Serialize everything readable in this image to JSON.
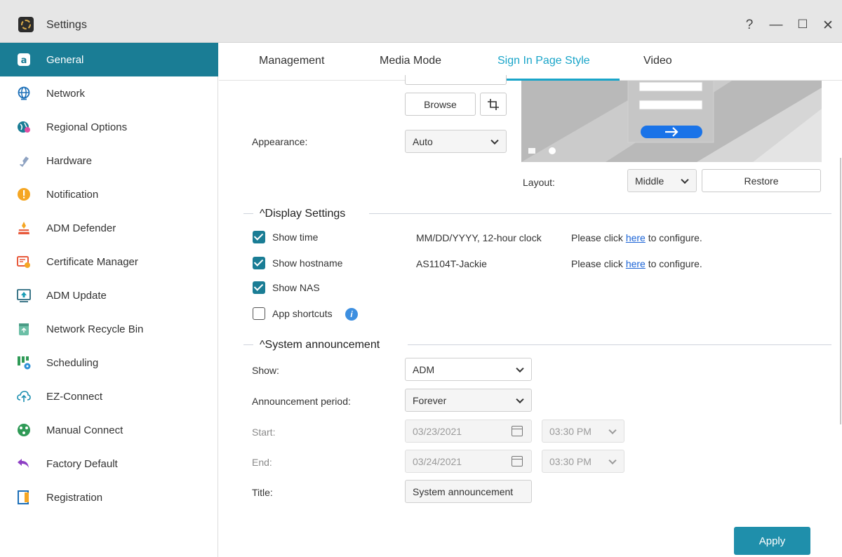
{
  "window": {
    "title": "Settings",
    "help_label": "?",
    "minimize_label": "—",
    "maximize_label": "☐",
    "close_label": "✕"
  },
  "sidebar": {
    "items": [
      {
        "label": "General",
        "icon": "general-icon"
      },
      {
        "label": "Network",
        "icon": "globe-icon"
      },
      {
        "label": "Regional Options",
        "icon": "regional-icon"
      },
      {
        "label": "Hardware",
        "icon": "hardware-icon"
      },
      {
        "label": "Notification",
        "icon": "notification-icon"
      },
      {
        "label": "ADM Defender",
        "icon": "defender-icon"
      },
      {
        "label": "Certificate Manager",
        "icon": "certificate-icon"
      },
      {
        "label": "ADM Update",
        "icon": "update-icon"
      },
      {
        "label": "Network Recycle Bin",
        "icon": "recycle-bin-icon"
      },
      {
        "label": "Scheduling",
        "icon": "scheduling-icon"
      },
      {
        "label": "EZ-Connect",
        "icon": "cloud-icon"
      },
      {
        "label": "Manual Connect",
        "icon": "manual-connect-icon"
      },
      {
        "label": "Factory Default",
        "icon": "undo-icon"
      },
      {
        "label": "Registration",
        "icon": "registration-icon"
      }
    ]
  },
  "tabs": [
    "Management",
    "Media Mode",
    "Sign In Page Style",
    "Video"
  ],
  "appearance": {
    "browse_label": "Browse",
    "label": "Appearance:",
    "value": "Auto",
    "layout_label": "Layout:",
    "layout_value": "Middle",
    "restore_label": "Restore"
  },
  "display_settings": {
    "title": "Display Settings",
    "show_time": {
      "label": "Show time",
      "checked": true,
      "value": "MM/DD/YYYY, 12-hour clock"
    },
    "show_hostname": {
      "label": "Show hostname",
      "checked": true,
      "value": "AS1104T-Jackie"
    },
    "show_nas": {
      "label": "Show NAS",
      "checked": true
    },
    "app_shortcuts": {
      "label": "App shortcuts",
      "checked": false
    },
    "config_prefix": "Please click ",
    "config_link": "here",
    "config_suffix": " to configure."
  },
  "system_announcement": {
    "title": "System announcement",
    "show_label": "Show:",
    "show_value": "ADM",
    "period_label": "Announcement period:",
    "period_value": "Forever",
    "start_label": "Start:",
    "start_date": "03/23/2021",
    "start_time": "03:30 PM",
    "end_label": "End:",
    "end_date": "03/24/2021",
    "end_time": "03:30 PM",
    "title_label": "Title:",
    "title_value": "System announcement"
  },
  "apply_label": "Apply",
  "colors": {
    "accent": "#1a7d95",
    "tab_active": "#1aa5c9",
    "apply": "#1f8fab",
    "link": "#1a63d6"
  }
}
